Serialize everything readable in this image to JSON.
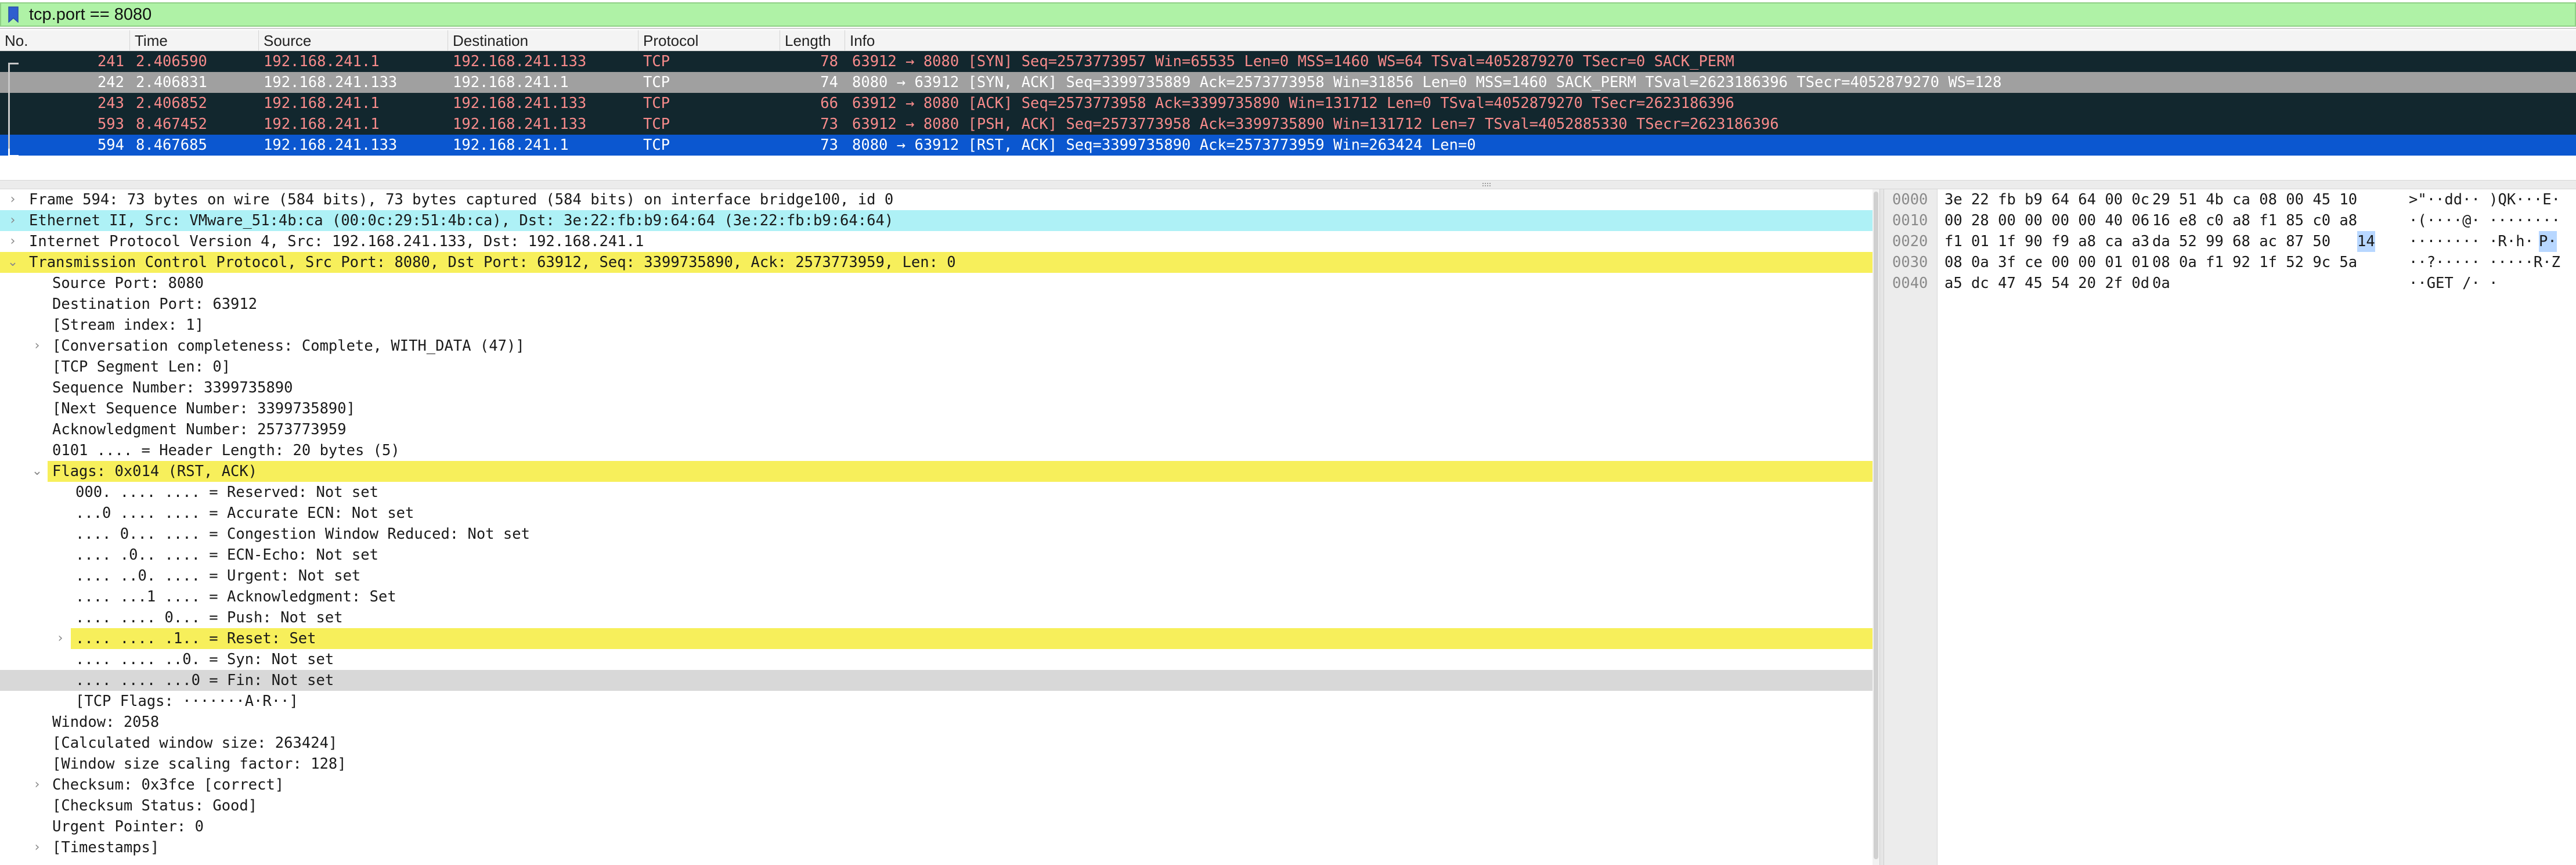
{
  "filter": {
    "value": "tcp.port == 8080"
  },
  "columns": [
    "No.",
    "Time",
    "Source",
    "Destination",
    "Protocol",
    "Length",
    "Info"
  ],
  "packets": [
    {
      "no": "241",
      "time": "2.406590",
      "source": "192.168.241.1",
      "destination": "192.168.241.133",
      "protocol": "TCP",
      "length": "78",
      "info": "63912 → 8080 [SYN] Seq=2573773957 Win=65535 Len=0 MSS=1460 WS=64 TSval=4052879270 TSecr=0 SACK_PERM"
    },
    {
      "no": "242",
      "time": "2.406831",
      "source": "192.168.241.133",
      "destination": "192.168.241.1",
      "protocol": "TCP",
      "length": "74",
      "info": "8080 → 63912 [SYN, ACK] Seq=3399735889 Ack=2573773958 Win=31856 Len=0 MSS=1460 SACK_PERM TSval=2623186396 TSecr=4052879270 WS=128"
    },
    {
      "no": "243",
      "time": "2.406852",
      "source": "192.168.241.1",
      "destination": "192.168.241.133",
      "protocol": "TCP",
      "length": "66",
      "info": "63912 → 8080 [ACK] Seq=2573773958 Ack=3399735890 Win=131712 Len=0 TSval=4052879270 TSecr=2623186396"
    },
    {
      "no": "593",
      "time": "8.467452",
      "source": "192.168.241.1",
      "destination": "192.168.241.133",
      "protocol": "TCP",
      "length": "73",
      "info": "63912 → 8080 [PSH, ACK] Seq=2573773958 Ack=3399735890 Win=131712 Len=7 TSval=4052885330 TSecr=2623186396"
    },
    {
      "no": "594",
      "time": "8.467685",
      "source": "192.168.241.133",
      "destination": "192.168.241.1",
      "protocol": "TCP",
      "length": "73",
      "info": "8080 → 63912 [RST, ACK] Seq=3399735890 Ack=2573773959 Win=263424 Len=0"
    }
  ],
  "details": [
    {
      "text": "Frame 594: 73 bytes on wire (584 bits), 73 bytes captured (584 bits) on interface bridge100, id 0",
      "expander": "collapsed"
    },
    {
      "text": "Ethernet II, Src: VMware_51:4b:ca (00:0c:29:51:4b:ca), Dst: 3e:22:fb:b9:64:64 (3e:22:fb:b9:64:64)",
      "expander": "collapsed"
    },
    {
      "text": "Internet Protocol Version 4, Src: 192.168.241.133, Dst: 192.168.241.1",
      "expander": "collapsed"
    },
    {
      "text": "Transmission Control Protocol, Src Port: 8080, Dst Port: 63912, Seq: 3399735890, Ack: 2573773959, Len: 0",
      "expander": "expanded"
    },
    {
      "text": "Source Port: 8080"
    },
    {
      "text": "Destination Port: 63912"
    },
    {
      "text": "[Stream index: 1]"
    },
    {
      "text": "[Conversation completeness: Complete, WITH_DATA (47)]",
      "expander": "collapsed"
    },
    {
      "text": "[TCP Segment Len: 0]"
    },
    {
      "text": "Sequence Number: 3399735890"
    },
    {
      "text": "[Next Sequence Number: 3399735890]"
    },
    {
      "text": "Acknowledgment Number: 2573773959"
    },
    {
      "text": "0101 .... = Header Length: 20 bytes (5)"
    },
    {
      "text": "Flags: 0x014 (RST, ACK)",
      "expander": "expanded"
    },
    {
      "text": "000. .... .... = Reserved: Not set"
    },
    {
      "text": "...0 .... .... = Accurate ECN: Not set"
    },
    {
      "text": ".... 0... .... = Congestion Window Reduced: Not set"
    },
    {
      "text": ".... .0.. .... = ECN-Echo: Not set"
    },
    {
      "text": ".... ..0. .... = Urgent: Not set"
    },
    {
      "text": ".... ...1 .... = Acknowledgment: Set"
    },
    {
      "text": ".... .... 0... = Push: Not set"
    },
    {
      "text": ".... .... .1.. = Reset: Set",
      "expander": "collapsed"
    },
    {
      "text": ".... .... ..0. = Syn: Not set"
    },
    {
      "text": ".... .... ...0 = Fin: Not set"
    },
    {
      "text": "[TCP Flags: ·······A·R··]"
    },
    {
      "text": "Window: 2058"
    },
    {
      "text": "[Calculated window size: 263424]"
    },
    {
      "text": "[Window size scaling factor: 128]"
    },
    {
      "text": "Checksum: 0x3fce [correct]",
      "expander": "collapsed"
    },
    {
      "text": "[Checksum Status: Good]"
    },
    {
      "text": "Urgent Pointer: 0"
    },
    {
      "text": "[Timestamps]",
      "expander": "collapsed"
    }
  ],
  "bytes": [
    {
      "offset": "0000",
      "hex_a": "3e 22 fb b9 64 64 00 0c",
      "hex_b": "29 51 4b ca 08 00 45 10",
      "ascii": ">\"··dd·· )QK···E·"
    },
    {
      "offset": "0010",
      "hex_a": "00 28 00 00 00 00 40 06",
      "hex_b": "16 e8 c0 a8 f1 85 c0 a8",
      "ascii": "·(····@· ········"
    },
    {
      "offset": "0020",
      "hex_a": "f1 01 1f 90 f9 a8 ca a3",
      "hex_b": "da 52 99 68 ac 87 50",
      "hex_sel": "14",
      "ascii_a": "········ ·R·h·",
      "ascii_sel": "P·"
    },
    {
      "offset": "0030",
      "hex_a": "08 0a 3f ce 00 00 01 01",
      "hex_b": "08 0a f1 92 1f 52 9c 5a",
      "ascii": "··?····· ·····R·Z"
    },
    {
      "offset": "0040",
      "hex_a": "a5 dc 47 45 54 20 2f 0d",
      "hex_b": "0a",
      "ascii": "··GET /· ·"
    }
  ],
  "colors": {
    "filter_valid": "#aff2a6",
    "row_dark": "#12272e",
    "row_dark_text": "#f78b8b",
    "row_gray": "#a0a0a0",
    "row_selected": "#0b57d0",
    "highlight_cyan": "#aef1f6",
    "highlight_yellow": "#f7ef5b",
    "highlight_gray": "#d8d8d8"
  }
}
